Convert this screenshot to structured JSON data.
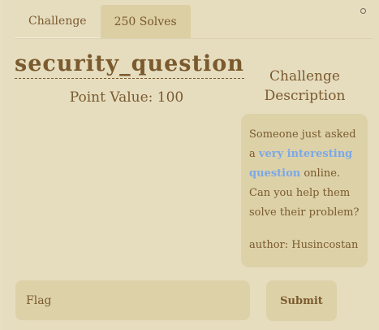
{
  "tabs": [
    {
      "label": "Challenge"
    },
    {
      "label": "250 Solves"
    }
  ],
  "challenge": {
    "title": "security_question",
    "points": "Point Value: 100",
    "description_header": "Challenge Description",
    "description_before": "Someone just asked a ",
    "description_link": "very interesting question",
    "description_after": " online. Can you help them solve their problem?",
    "author": "author: Husincostan"
  },
  "flag": {
    "placeholder": "Flag",
    "submit_label": "Submit"
  },
  "colors": {
    "background": "#e8dfc2",
    "text": "#7a5a2e",
    "link": "#7aa8e8",
    "box": "#ddd1a8"
  }
}
